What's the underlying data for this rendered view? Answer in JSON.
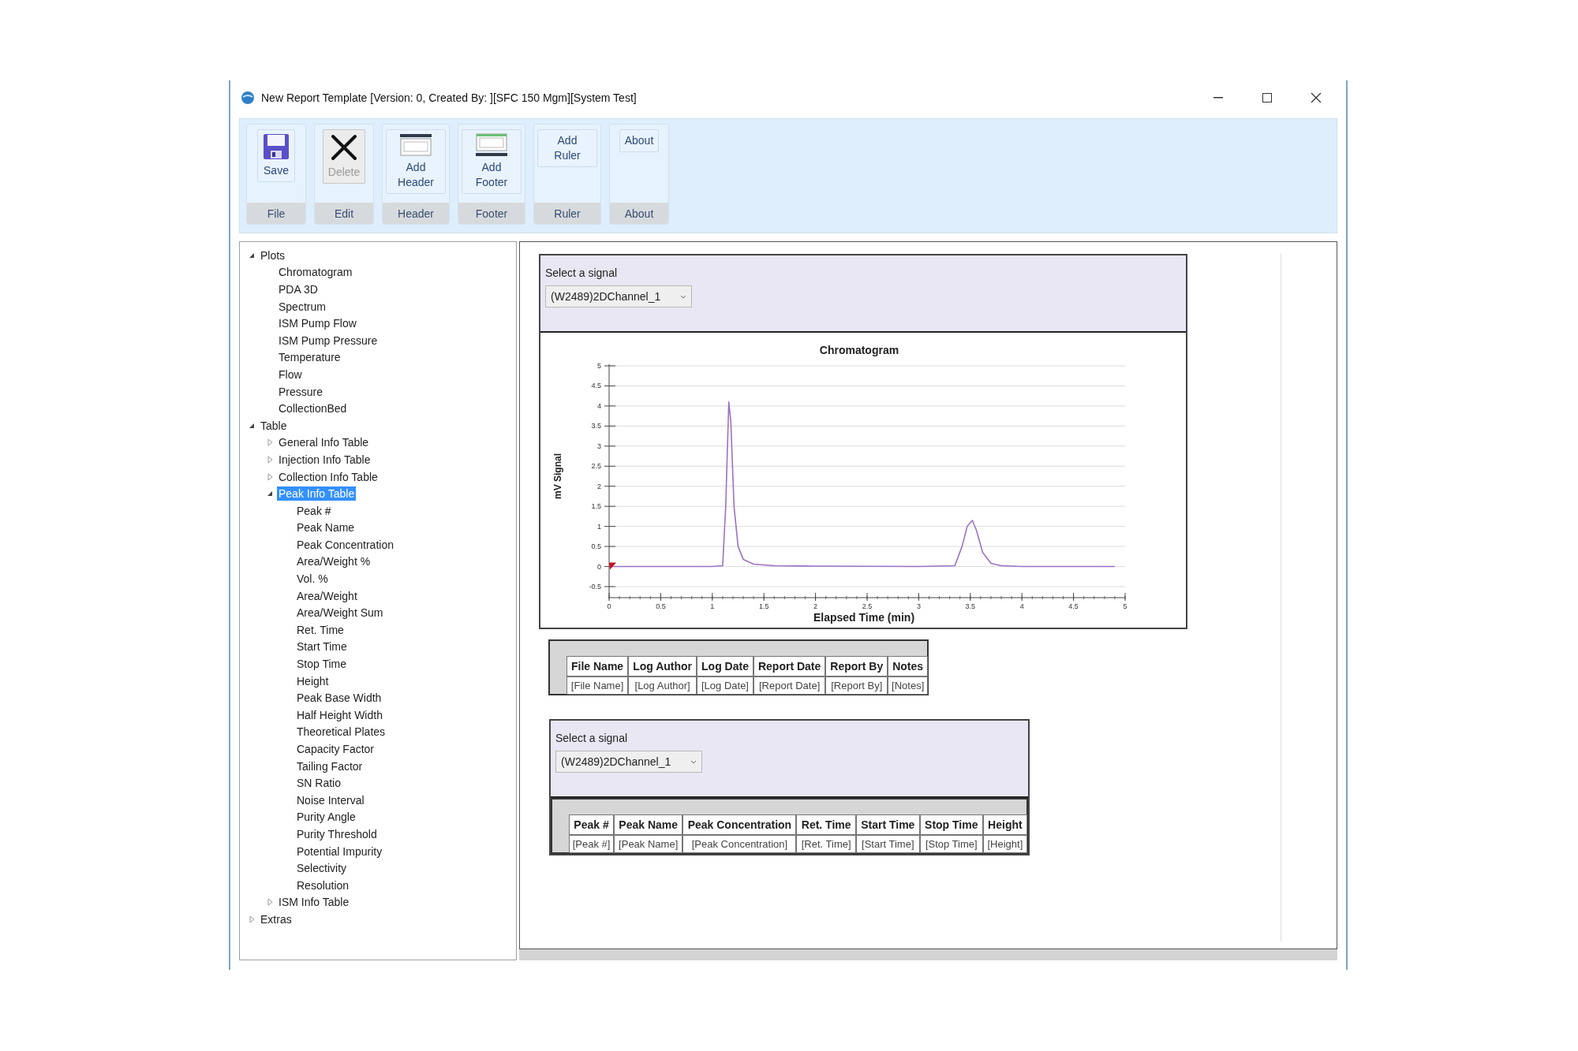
{
  "window": {
    "title": "New Report Template [Version: 0, Created By: ][SFC 150 Mgm][System Test]"
  },
  "ribbon": {
    "groups": [
      {
        "label": "File",
        "button": {
          "label": "Save",
          "disabled": false
        }
      },
      {
        "label": "Edit",
        "button": {
          "label": "Delete",
          "disabled": true
        }
      },
      {
        "label": "Header",
        "button": {
          "label": "Add Header",
          "disabled": false
        }
      },
      {
        "label": "Footer",
        "button": {
          "label": "Add Footer",
          "disabled": false
        }
      },
      {
        "label": "Ruler",
        "button": {
          "label": "Add Ruler",
          "disabled": false
        }
      },
      {
        "label": "About",
        "button": {
          "label": "About",
          "disabled": false
        }
      }
    ]
  },
  "tree": {
    "items": [
      {
        "label": "Plots",
        "expanded": true,
        "selected": false,
        "children": [
          {
            "label": "Chromatogram",
            "selected": false
          },
          {
            "label": "PDA 3D",
            "selected": false
          },
          {
            "label": "Spectrum",
            "selected": false
          },
          {
            "label": "ISM Pump Flow",
            "selected": false
          },
          {
            "label": "ISM Pump Pressure",
            "selected": false
          },
          {
            "label": "Temperature",
            "selected": false
          },
          {
            "label": "Flow",
            "selected": false
          },
          {
            "label": "Pressure",
            "selected": false
          },
          {
            "label": "CollectionBed",
            "selected": false
          }
        ]
      },
      {
        "label": "Table",
        "expanded": true,
        "selected": false,
        "children": [
          {
            "label": "General Info Table",
            "expanded": false,
            "selected": false
          },
          {
            "label": "Injection Info Table",
            "expanded": false,
            "selected": false
          },
          {
            "label": "Collection Info Table",
            "expanded": false,
            "selected": false
          },
          {
            "label": "Peak Info Table",
            "expanded": true,
            "selected": true,
            "children": [
              {
                "label": "Peak #",
                "selected": false
              },
              {
                "label": "Peak Name",
                "selected": false
              },
              {
                "label": "Peak Concentration",
                "selected": false
              },
              {
                "label": "Area/Weight %",
                "selected": false
              },
              {
                "label": "Vol. %",
                "selected": false
              },
              {
                "label": "Area/Weight",
                "selected": false
              },
              {
                "label": "Area/Weight Sum",
                "selected": false
              },
              {
                "label": "Ret. Time",
                "selected": false
              },
              {
                "label": "Start Time",
                "selected": false
              },
              {
                "label": "Stop Time",
                "selected": false
              },
              {
                "label": "Height",
                "selected": false
              },
              {
                "label": "Peak Base Width",
                "selected": false
              },
              {
                "label": "Half Height Width",
                "selected": false
              },
              {
                "label": "Theoretical Plates",
                "selected": false
              },
              {
                "label": "Capacity Factor",
                "selected": false
              },
              {
                "label": "Tailing Factor",
                "selected": false
              },
              {
                "label": "SN Ratio",
                "selected": false
              },
              {
                "label": "Noise Interval",
                "selected": false
              },
              {
                "label": "Purity Angle",
                "selected": false
              },
              {
                "label": "Purity Threshold",
                "selected": false
              },
              {
                "label": "Potential Impurity",
                "selected": false
              },
              {
                "label": "Selectivity",
                "selected": false
              },
              {
                "label": "Resolution",
                "selected": false
              }
            ]
          },
          {
            "label": "ISM Info Table",
            "expanded": false,
            "selected": false
          }
        ]
      },
      {
        "label": "Extras",
        "expanded": false,
        "selected": false
      }
    ]
  },
  "report": {
    "sections": [
      {
        "kind": "chart",
        "signal": {
          "label": "Select a signal",
          "value": "(W2489)2DChannel_1"
        },
        "chart_data": {
          "type": "line",
          "title": "Chromatogram",
          "xlabel": "Elapsed Time (min)",
          "ylabel": "mV Signal",
          "x": [
            0,
            0.5,
            1.0,
            1.1,
            1.13,
            1.16,
            1.18,
            1.21,
            1.25,
            1.3,
            1.4,
            1.6,
            2,
            3,
            3.35,
            3.42,
            3.47,
            3.52,
            3.56,
            3.62,
            3.7,
            3.8,
            4,
            4.5,
            4.9
          ],
          "grid": true,
          "series": [
            {
              "color": "#9b72c4",
              "values": [
                0,
                0,
                0,
                0.02,
                1.5,
                4.1,
                3.6,
                1.5,
                0.5,
                0.18,
                0.06,
                0.02,
                0.01,
                0,
                0.02,
                0.5,
                1.0,
                1.15,
                0.9,
                0.35,
                0.08,
                0.02,
                0,
                0,
                0
              ]
            }
          ],
          "xlim": [
            0,
            5
          ],
          "ylim": [
            -0.5,
            5
          ],
          "xticks": [
            0,
            0.5,
            1,
            1.5,
            2,
            2.5,
            3,
            3.5,
            4,
            4.5,
            5
          ],
          "yticks": [
            -0.5,
            0,
            0.5,
            1,
            1.5,
            2,
            2.5,
            3,
            3.5,
            4,
            4.5,
            5
          ]
        }
      },
      {
        "kind": "table",
        "columns": [
          "File Name",
          "Log Author",
          "Log Date",
          "Report Date",
          "Report By",
          "Notes"
        ],
        "rows": [
          [
            "[File Name]",
            "[Log Author]",
            "[Log Date]",
            "[Report Date]",
            "[Report By]",
            "[Notes]"
          ]
        ]
      },
      {
        "kind": "signal_table",
        "signal": {
          "label": "Select a signal",
          "value": "(W2489)2DChannel_1"
        },
        "columns": [
          "Peak #",
          "Peak Name",
          "Peak Concentration",
          "Ret. Time",
          "Start Time",
          "Stop Time",
          "Height"
        ],
        "rows": [
          [
            "[Peak #]",
            "[Peak Name]",
            "[Peak Concentration]",
            "[Ret. Time]",
            "[Start Time]",
            "[Stop Time]",
            "[Height]"
          ]
        ]
      }
    ]
  }
}
